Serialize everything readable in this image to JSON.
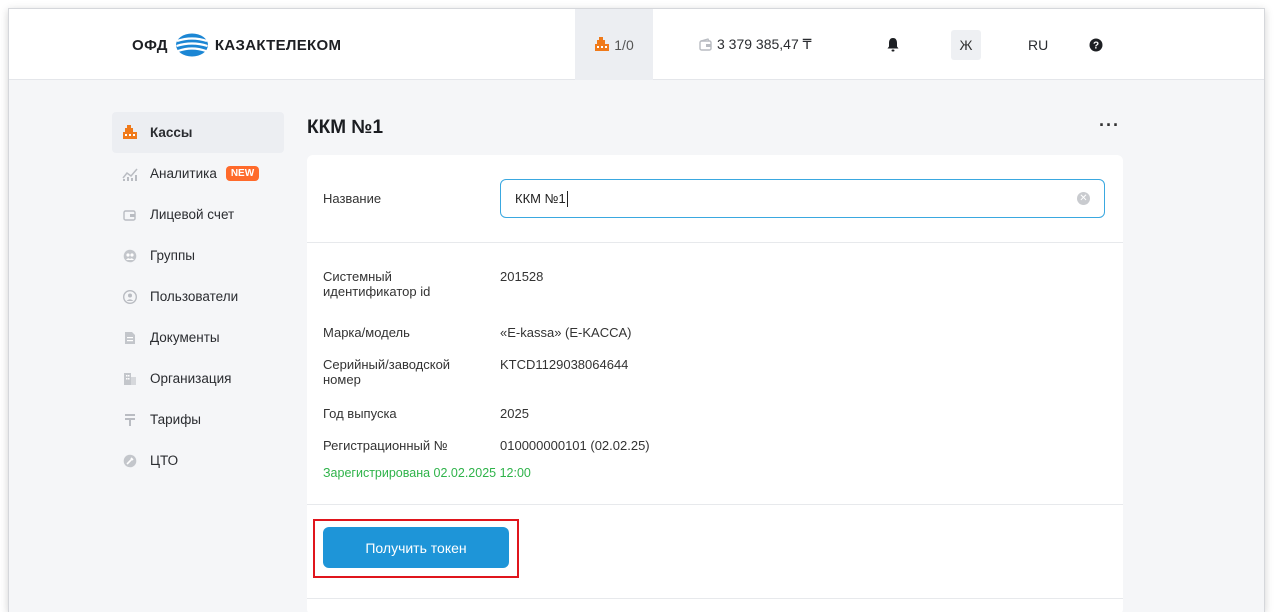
{
  "header": {
    "logo_ofd": "ОФД",
    "logo_brand": "КАЗАКТЕЛЕКОМ",
    "kassa_counter": "1/0",
    "balance": "3 379 385,47 ₸",
    "user_initial": "Ж",
    "language": "RU",
    "accent_color": "#1e95d8"
  },
  "sidebar": {
    "items": [
      {
        "label": "Кассы",
        "icon": "cash-register-icon",
        "active": true
      },
      {
        "label": "Аналитика",
        "icon": "analytics-icon",
        "badge": "NEW"
      },
      {
        "label": "Лицевой счет",
        "icon": "wallet-icon"
      },
      {
        "label": "Группы",
        "icon": "groups-icon"
      },
      {
        "label": "Пользователи",
        "icon": "user-icon"
      },
      {
        "label": "Документы",
        "icon": "document-icon"
      },
      {
        "label": "Организация",
        "icon": "building-icon"
      },
      {
        "label": "Тарифы",
        "icon": "tariff-icon"
      },
      {
        "label": "ЦТО",
        "icon": "service-center-icon"
      }
    ]
  },
  "main": {
    "title": "ККМ №1",
    "more_label": "···",
    "name_field": {
      "label": "Название",
      "value": "ККМ №1"
    },
    "details": [
      {
        "label": "Системный идентификатор id",
        "value": "201528"
      },
      {
        "label": "Марка/модель",
        "value": "«E-kassa» (E-KACCA)"
      },
      {
        "label": "Серийный/заводской номер",
        "value": "KTCD1129038064644"
      },
      {
        "label": "Год выпуска",
        "value": "2025"
      },
      {
        "label": "Регистрационный №",
        "value": "010000000101 (02.02.25)"
      }
    ],
    "status": "Зарегистрирована 02.02.2025 12:00",
    "status_color": "#2fb34a",
    "token_button": "Получить токен"
  }
}
